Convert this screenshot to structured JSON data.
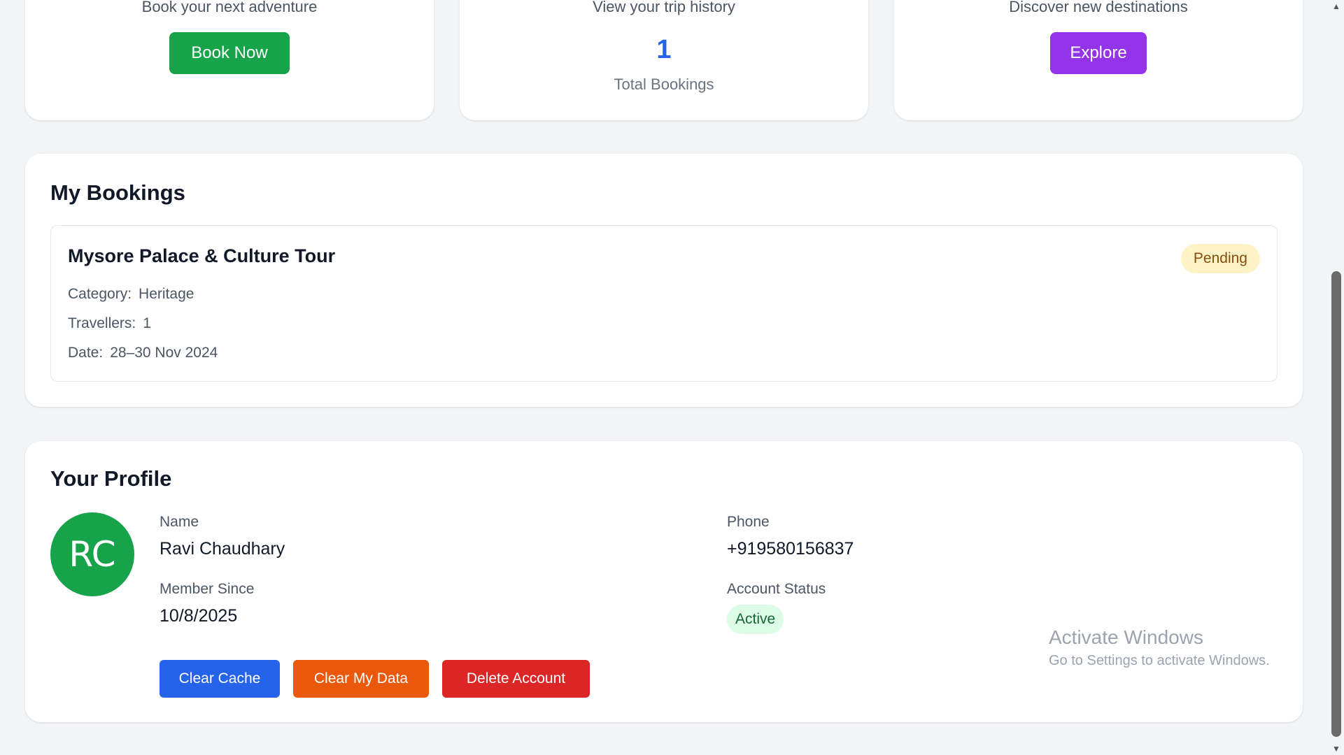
{
  "quick_cards": {
    "book": {
      "subtitle": "Book your next adventure",
      "button_label": "Book Now"
    },
    "history": {
      "subtitle": "View your trip history",
      "count": "1",
      "count_label": "Total Bookings"
    },
    "explore": {
      "subtitle": "Discover new destinations",
      "button_label": "Explore"
    }
  },
  "bookings": {
    "title": "My Bookings",
    "items": [
      {
        "name": "Mysore Palace & Culture Tour",
        "status": "Pending",
        "category_label": "Category:",
        "category": "Heritage",
        "travellers_label": "Travellers:",
        "travellers": "1",
        "date_label": "Date:",
        "date": "28–30 Nov 2024"
      }
    ]
  },
  "profile": {
    "title": "Your Profile",
    "initials": "RC",
    "name_label": "Name",
    "name": "Ravi Chaudhary",
    "phone_label": "Phone",
    "phone": "+919580156837",
    "member_since_label": "Member Since",
    "member_since": "10/8/2025",
    "status_label": "Account Status",
    "status": "Active",
    "actions": {
      "clear_cache": "Clear Cache",
      "clear_data": "Clear My Data",
      "delete_account": "Delete Account"
    }
  },
  "watermark": {
    "title": "Activate Windows",
    "subtitle": "Go to Settings to activate Windows."
  },
  "scrollbar": {
    "up_icon": "▲",
    "down_icon": "▼"
  },
  "colors": {
    "green": "#16a34a",
    "purple": "#9333ea",
    "blue": "#2563eb",
    "orange": "#ea580c",
    "red": "#dc2626",
    "pending_bg": "#fef3c7",
    "active_bg": "#dcfce7"
  }
}
